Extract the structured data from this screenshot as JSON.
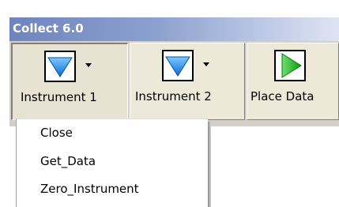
{
  "window": {
    "title": "Collect 6.0"
  },
  "toolbar": {
    "buttons": [
      {
        "label": "Instrument 1",
        "icon": "blue-down-triangle-icon",
        "has_dropdown": true,
        "state": "pressed"
      },
      {
        "label": "Instrument 2",
        "icon": "blue-down-triangle-icon",
        "has_dropdown": true,
        "state": "normal"
      },
      {
        "label": "Place Data",
        "icon": "green-play-icon",
        "has_dropdown": false,
        "state": "normal"
      }
    ]
  },
  "menu": {
    "items": [
      "Close",
      "Get_Data",
      "Zero_Instrument"
    ]
  },
  "colors": {
    "title_gradient_start": "#6f84bf",
    "title_gradient_end": "#dfe4f2",
    "title_text": "#ffffff",
    "toolbar_face": "#ece9d8",
    "toolbar_background": "#d4d0c8",
    "icon_blue": "#1e8fe6",
    "icon_green": "#18b418"
  }
}
